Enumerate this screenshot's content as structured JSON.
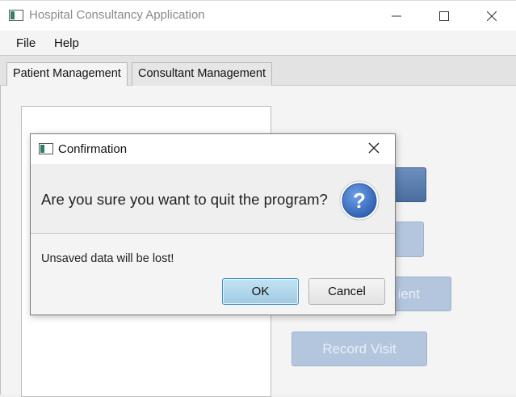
{
  "window": {
    "title": "Hospital Consultancy Application",
    "icon": "app-window-icon",
    "controls": [
      "minimize-icon",
      "maximize-icon",
      "close-icon"
    ]
  },
  "menu": {
    "items": [
      {
        "label": "File"
      },
      {
        "label": "Help"
      }
    ]
  },
  "tabs": [
    {
      "label": "Patient Management",
      "active": true
    },
    {
      "label": "Consultant Management",
      "active": false
    }
  ],
  "background_buttons": [
    {
      "label": ""
    },
    {
      "label": ""
    },
    {
      "label": "ient"
    },
    {
      "label": "Record Visit"
    }
  ],
  "dialog": {
    "title": "Confirmation",
    "question": "Are you sure you want to quit the program?",
    "message": "Unsaved data will be lost!",
    "ok_label": "OK",
    "cancel_label": "Cancel",
    "icon": "question-icon"
  },
  "colors": {
    "accent_blue": "#4a6f9e",
    "disabled_blue": "#b4c6de",
    "default_button_border": "#3f8ec4",
    "question_icon": "#3a6fc0"
  }
}
